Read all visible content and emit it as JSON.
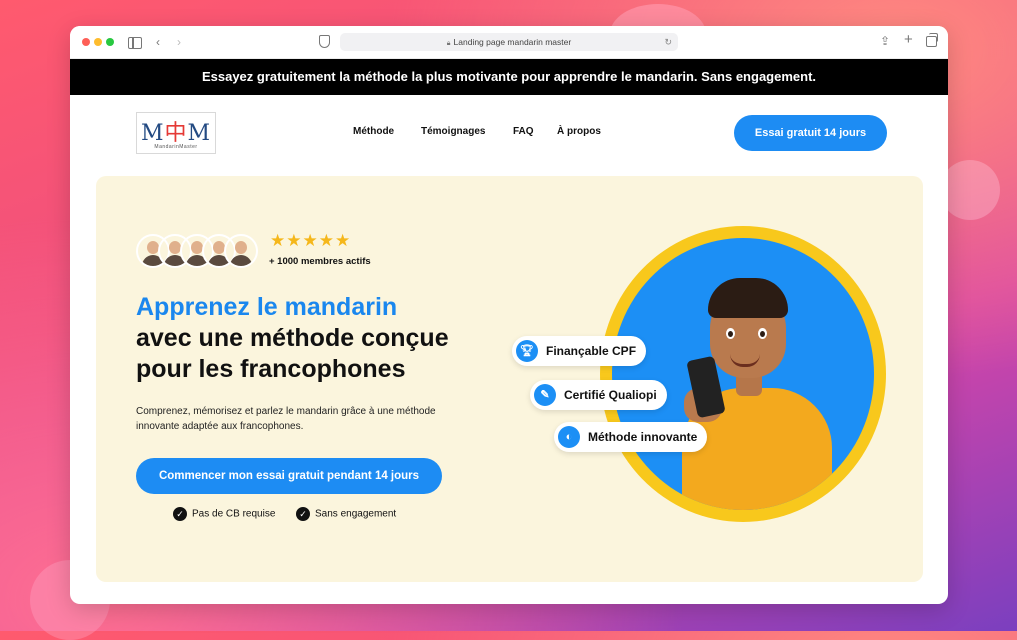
{
  "browser": {
    "url_text": "Landing page mandarin master"
  },
  "banner": {
    "text": "Essayez gratuitement la méthode la plus motivante pour apprendre le mandarin. Sans engagement."
  },
  "nav": {
    "logo_text": "MandarinMaster",
    "links": [
      "Méthode",
      "Témoignages",
      "FAQ",
      "À propos"
    ],
    "cta": "Essai gratuit 14 jours"
  },
  "hero": {
    "rating_stars": "★★★★★",
    "members": "+ 1000 membres actifs",
    "headline_blue": "Apprenez le mandarin",
    "headline_line2": "avec une méthode conçue",
    "headline_line3": "pour les francophones",
    "description": "Comprenez, mémorisez et parlez le mandarin grâce à une méthode innovante adaptée aux francophones.",
    "cta": "Commencer mon essai gratuit pendant 14 jours",
    "checks": [
      "Pas de CB requise",
      "Sans engagement"
    ],
    "badges": [
      "Finançable CPF",
      "Certifié Qualiopi",
      "Méthode innovante"
    ]
  },
  "colors": {
    "accent_blue": "#1d8cf3",
    "hero_bg": "#fbf5dd",
    "ring_yellow": "#f8c81c"
  }
}
